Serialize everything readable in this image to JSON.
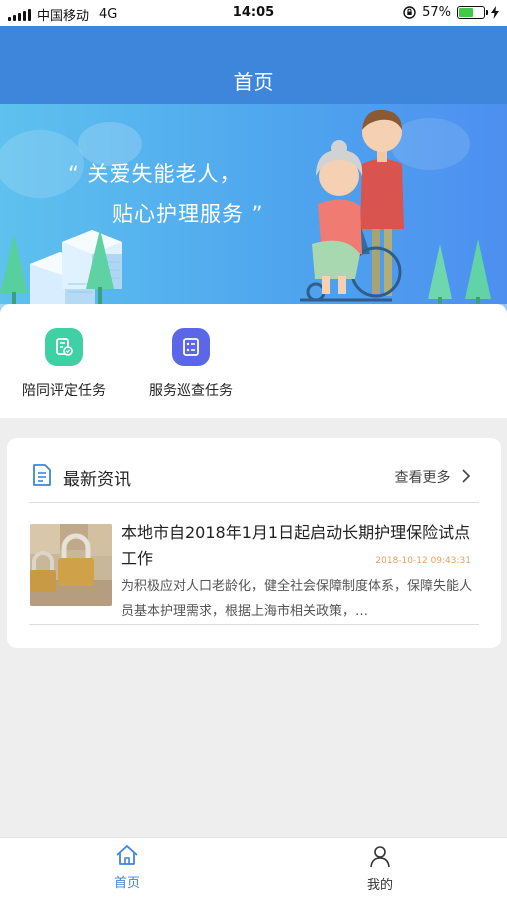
{
  "status_bar": {
    "carrier": "中国移动",
    "network": "4G",
    "time": "14:05",
    "battery_percent": "57%",
    "battery_level": 0.57
  },
  "header": {
    "title": "首页"
  },
  "banner": {
    "line1": "“ 关爱失能老人，",
    "line2": "贴心护理服务 ”"
  },
  "tasks": [
    {
      "label": "陪同评定任务",
      "icon": "document-check-icon",
      "color": "#3fd0a3"
    },
    {
      "label": "服务巡查任务",
      "icon": "checklist-icon",
      "color": "#5b67e8"
    }
  ],
  "news": {
    "title": "最新资讯",
    "more_label": "查看更多",
    "items": [
      {
        "headline": "本地市自2018年1月1日起启动长期护理保险试点工作",
        "time": "2018-10-12 09:43:31",
        "summary": "为积极应对人口老龄化，健全社会保障制度体系，保障失能人员基本护理需求，根据上海市相关政策，…"
      }
    ]
  },
  "tab_bar": {
    "home_label": "首页",
    "mine_label": "我的",
    "active_color": "#3d86dc"
  }
}
